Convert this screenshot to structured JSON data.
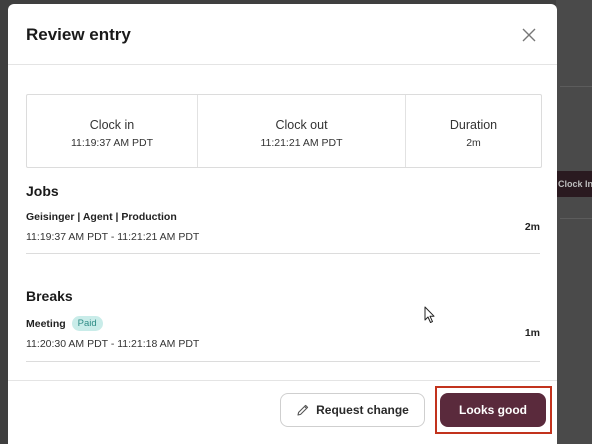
{
  "background": {
    "chip_label": "Clock In"
  },
  "modal": {
    "title": "Review entry",
    "close_icon": "close-icon"
  },
  "summary": {
    "clock_in": {
      "label": "Clock in",
      "value": "11:19:37 AM PDT"
    },
    "clock_out": {
      "label": "Clock out",
      "value": "11:21:21 AM PDT"
    },
    "duration": {
      "label": "Duration",
      "value": "2m"
    }
  },
  "jobs": {
    "title": "Jobs",
    "items": [
      {
        "name": "Geisinger | Agent | Production",
        "time_range": "11:19:37 AM PDT - 11:21:21 AM PDT",
        "duration": "2m"
      }
    ]
  },
  "breaks": {
    "title": "Breaks",
    "items": [
      {
        "name": "Meeting",
        "badge": "Paid",
        "time_range": "11:20:30 AM PDT - 11:21:18 AM PDT",
        "duration": "1m"
      }
    ]
  },
  "footer": {
    "request_change_label": "Request change",
    "request_change_icon": "pencil-icon",
    "looks_good_label": "Looks good"
  },
  "colors": {
    "primary": "#5a2a3c",
    "badge_bg": "#c9ece9",
    "badge_text": "#2f8c86",
    "highlight": "#c2331d"
  }
}
